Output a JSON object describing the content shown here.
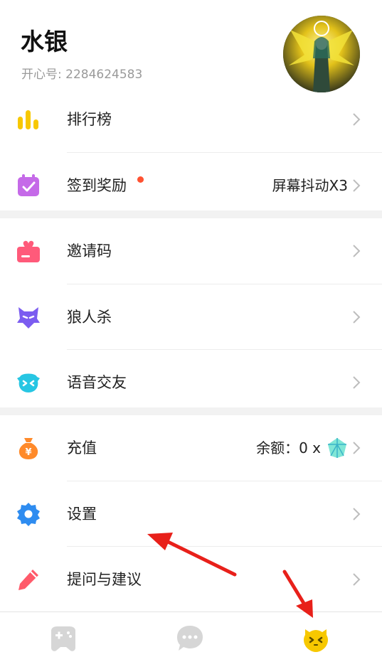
{
  "profile": {
    "name": "水银",
    "id_line": "开心号: 2284624583"
  },
  "menu": {
    "leaderboard": {
      "label": "排行榜",
      "icon": "bar-chart-icon",
      "color": "#f7c800"
    },
    "checkin": {
      "label": "签到奖励",
      "value": "屏幕抖动X3",
      "icon": "calendar-check-icon",
      "color": "#c56ae8",
      "badge_color": "#ff5232"
    },
    "invite": {
      "label": "邀请码",
      "icon": "invite-ticket-icon",
      "color": "#ff5a7a"
    },
    "werewolf": {
      "label": "狼人杀",
      "icon": "werewolf-icon",
      "color": "#7b5cf0"
    },
    "voice": {
      "label": "语音交友",
      "icon": "voice-chat-icon",
      "color": "#27c6e3"
    },
    "recharge": {
      "label": "充值",
      "value": "余额：0 x",
      "icon": "money-bag-icon",
      "color": "#ff8a2a"
    },
    "settings": {
      "label": "设置",
      "icon": "gear-icon",
      "color": "#2e8cf0"
    },
    "feedback": {
      "label": "提问与建议",
      "icon": "pencil-icon",
      "color": "#ff5a6a"
    }
  },
  "tabbar": {
    "tabs": [
      {
        "name": "games",
        "icon": "gamepad-icon",
        "active": false
      },
      {
        "name": "messages",
        "icon": "chat-bubble-icon",
        "active": false
      },
      {
        "name": "me",
        "icon": "face-icon",
        "active": true
      }
    ],
    "active_color": "#f7c800",
    "inactive_color": "#d6d6d6"
  },
  "annotations": {
    "arrow_color": "#e8201a"
  }
}
